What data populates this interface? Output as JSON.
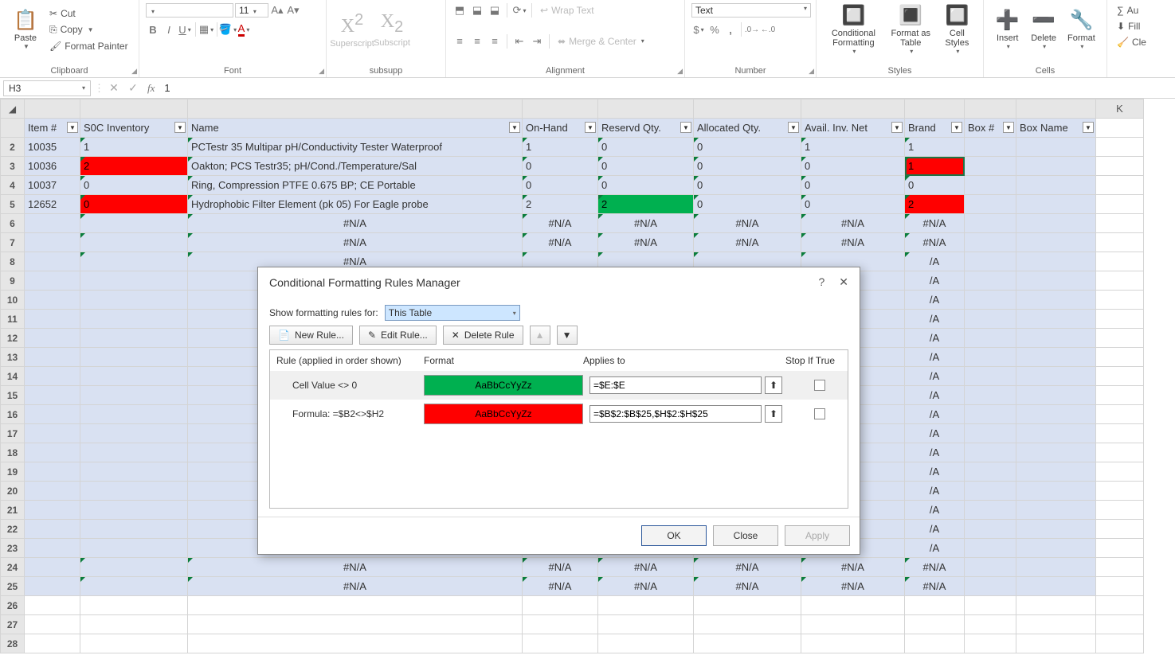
{
  "ribbon": {
    "clipboard": {
      "title": "Clipboard",
      "paste": "Paste",
      "cut": "Cut",
      "copy": "Copy",
      "format_painter": "Format Painter"
    },
    "font": {
      "title": "Font",
      "font_name": "",
      "font_size": "11"
    },
    "subsupp": {
      "title": "subsupp",
      "superscript": "Superscript",
      "subscript": "Subscript"
    },
    "alignment": {
      "title": "Alignment",
      "wrap": "Wrap Text",
      "merge": "Merge & Center"
    },
    "number": {
      "title": "Number",
      "format": "Text"
    },
    "styles": {
      "title": "Styles",
      "cond": "Conditional Formatting",
      "table": "Format as Table",
      "cell": "Cell Styles"
    },
    "cells": {
      "title": "Cells",
      "insert": "Insert",
      "delete": "Delete",
      "format": "Format"
    },
    "editing": {
      "auto": "Au",
      "fill": "Fill",
      "clear": "Cle"
    }
  },
  "formula_bar": {
    "name_box": "H3",
    "formula": "1"
  },
  "col_letters": [
    "",
    "",
    "",
    "",
    "",
    "",
    "",
    "",
    "",
    "",
    "",
    "K"
  ],
  "headers": [
    "Item #",
    "S0C Inventory",
    "Name",
    "On-Hand",
    "Reservd Qty.",
    "Allocated Qty.",
    "Avail. Inv. Net",
    "Brand",
    "Box #",
    "Box Name"
  ],
  "rows": [
    {
      "n": 2,
      "band": true,
      "cells": [
        "10035",
        "1",
        "PCTestr 35  Multipar pH/Conductivity Tester Waterproof",
        "1",
        "0",
        "0",
        "1",
        "1",
        "",
        ""
      ]
    },
    {
      "n": 3,
      "band": true,
      "cells": [
        "10036",
        "2",
        "Oakton; PCS Testr35; pH/Cond./Temperature/Sal",
        "0",
        "0",
        "0",
        "0",
        "1",
        "",
        ""
      ],
      "red": [
        1,
        7
      ],
      "sel": 7
    },
    {
      "n": 4,
      "band": true,
      "cells": [
        "10037",
        "0",
        "Ring, Compression PTFE 0.675 BP; CE Portable",
        "0",
        "0",
        "0",
        "0",
        "0",
        "",
        ""
      ]
    },
    {
      "n": 5,
      "band": true,
      "cells": [
        "12652",
        "0",
        "Hydrophobic Filter Element (pk 05) For Eagle probe",
        "2",
        "2",
        "0",
        "0",
        "2",
        "",
        ""
      ],
      "red": [
        1,
        7
      ],
      "green": [
        4
      ]
    },
    {
      "n": 6,
      "band": true,
      "na": true
    },
    {
      "n": 7,
      "band": true,
      "na": true
    },
    {
      "n": 8,
      "band": true,
      "na": true,
      "partial": true,
      "naSuffix": "/A"
    },
    {
      "n": 9,
      "band": true,
      "na": true,
      "hidden": true,
      "naSuffix": "/A"
    },
    {
      "n": 10,
      "band": true,
      "na": true,
      "hidden": true,
      "naSuffix": "/A"
    },
    {
      "n": 11,
      "band": true,
      "na": true,
      "hidden": true,
      "naSuffix": "/A"
    },
    {
      "n": 12,
      "band": true,
      "na": true,
      "hidden": true,
      "naSuffix": "/A"
    },
    {
      "n": 13,
      "band": true,
      "na": true,
      "hidden": true,
      "naSuffix": "/A"
    },
    {
      "n": 14,
      "band": true,
      "na": true,
      "hidden": true,
      "naSuffix": "/A"
    },
    {
      "n": 15,
      "band": true,
      "na": true,
      "hidden": true,
      "naSuffix": "/A"
    },
    {
      "n": 16,
      "band": true,
      "na": true,
      "hidden": true,
      "naSuffix": "/A"
    },
    {
      "n": 17,
      "band": true,
      "na": true,
      "hidden": true,
      "naSuffix": "/A"
    },
    {
      "n": 18,
      "band": true,
      "na": true,
      "hidden": true,
      "naSuffix": "/A"
    },
    {
      "n": 19,
      "band": true,
      "na": true,
      "hidden": true,
      "naSuffix": "/A"
    },
    {
      "n": 20,
      "band": true,
      "na": true,
      "hidden": true,
      "naSuffix": "/A"
    },
    {
      "n": 21,
      "band": true,
      "na": true,
      "hidden": true,
      "naSuffix": "/A"
    },
    {
      "n": 22,
      "band": true,
      "na": true,
      "hidden": true,
      "naSuffix": "/A"
    },
    {
      "n": 23,
      "band": true,
      "na": true,
      "hidden": true,
      "naSuffix": "/A"
    },
    {
      "n": 24,
      "band": true,
      "na": true
    },
    {
      "n": 25,
      "band": true,
      "na": true
    },
    {
      "n": 26,
      "band": false,
      "empty": true
    },
    {
      "n": 27,
      "band": false,
      "empty": true
    },
    {
      "n": 28,
      "band": false,
      "empty": true
    }
  ],
  "na_text": "#N/A",
  "dialog": {
    "title": "Conditional Formatting Rules Manager",
    "show_for_label": "Show formatting rules for:",
    "show_for_value": "This Table",
    "new_rule": "New Rule...",
    "edit_rule": "Edit Rule...",
    "delete_rule": "Delete Rule",
    "col_rule": "Rule (applied in order shown)",
    "col_format": "Format",
    "col_applies": "Applies to",
    "col_stop": "Stop If True",
    "sample": "AaBbCcYyZz",
    "rules": [
      {
        "desc": "Cell Value <> 0",
        "color": "green",
        "applies": "=$E:$E",
        "selected": true
      },
      {
        "desc": "Formula: =$B2<>$H2",
        "color": "red",
        "applies": "=$B$2:$B$25,$H$2:$H$25",
        "selected": false
      }
    ],
    "ok": "OK",
    "close": "Close",
    "apply": "Apply"
  }
}
